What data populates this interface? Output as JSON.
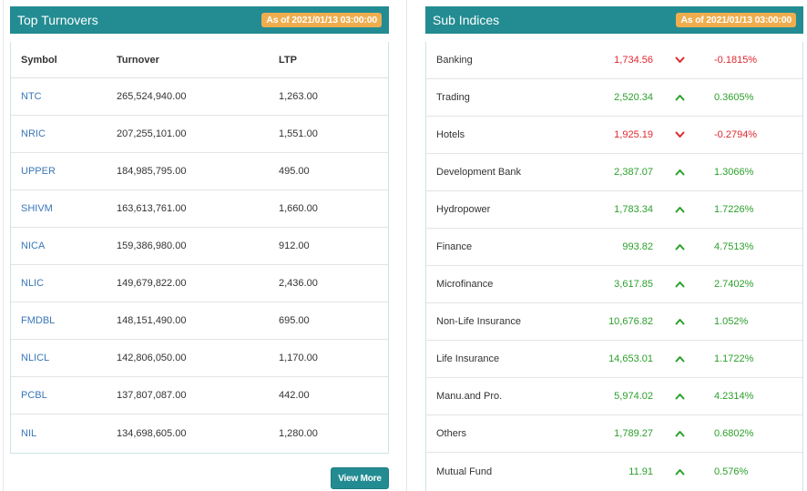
{
  "turnovers": {
    "title": "Top Turnovers",
    "as_of": "As of 2021/01/13 03:00:00",
    "headers": {
      "symbol": "Symbol",
      "turnover": "Turnover",
      "ltp": "LTP"
    },
    "rows": [
      {
        "symbol": "NTC",
        "turnover": "265,524,940.00",
        "ltp": "1,263.00"
      },
      {
        "symbol": "NRIC",
        "turnover": "207,255,101.00",
        "ltp": "1,551.00"
      },
      {
        "symbol": "UPPER",
        "turnover": "184,985,795.00",
        "ltp": "495.00"
      },
      {
        "symbol": "SHIVM",
        "turnover": "163,613,761.00",
        "ltp": "1,660.00"
      },
      {
        "symbol": "NICA",
        "turnover": "159,386,980.00",
        "ltp": "912.00"
      },
      {
        "symbol": "NLIC",
        "turnover": "149,679,822.00",
        "ltp": "2,436.00"
      },
      {
        "symbol": "FMDBL",
        "turnover": "148,151,490.00",
        "ltp": "695.00"
      },
      {
        "symbol": "NLICL",
        "turnover": "142,806,050.00",
        "ltp": "1,170.00"
      },
      {
        "symbol": "PCBL",
        "turnover": "137,807,087.00",
        "ltp": "442.00"
      },
      {
        "symbol": "NIL",
        "turnover": "134,698,605.00",
        "ltp": "1,280.00"
      }
    ],
    "view_more_label": "View More"
  },
  "sub_indices": {
    "title": "Sub Indices",
    "as_of": "As of 2021/01/13 03:00:00",
    "colors": {
      "up": "#2ca02c",
      "down": "#e0282e"
    },
    "rows": [
      {
        "name": "Banking",
        "value": "1,734.56",
        "change": "-0.1815%",
        "direction": "down"
      },
      {
        "name": "Trading",
        "value": "2,520.34",
        "change": "0.3605%",
        "direction": "up"
      },
      {
        "name": "Hotels",
        "value": "1,925.19",
        "change": "-0.2794%",
        "direction": "down"
      },
      {
        "name": "Development Bank",
        "value": "2,387.07",
        "change": "1.3066%",
        "direction": "up"
      },
      {
        "name": "Hydropower",
        "value": "1,783.34",
        "change": "1.7226%",
        "direction": "up"
      },
      {
        "name": "Finance",
        "value": "993.82",
        "change": "4.7513%",
        "direction": "up"
      },
      {
        "name": "Microfinance",
        "value": "3,617.85",
        "change": "2.7402%",
        "direction": "up"
      },
      {
        "name": "Non-Life Insurance",
        "value": "10,676.82",
        "change": "1.052%",
        "direction": "up"
      },
      {
        "name": "Life Insurance",
        "value": "14,653.01",
        "change": "1.1722%",
        "direction": "up"
      },
      {
        "name": "Manu.and Pro.",
        "value": "5,974.02",
        "change": "4.2314%",
        "direction": "up"
      },
      {
        "name": "Others",
        "value": "1,789.27",
        "change": "0.6802%",
        "direction": "up"
      },
      {
        "name": "Mutual Fund",
        "value": "11.91",
        "change": "0.576%",
        "direction": "up"
      }
    ]
  }
}
